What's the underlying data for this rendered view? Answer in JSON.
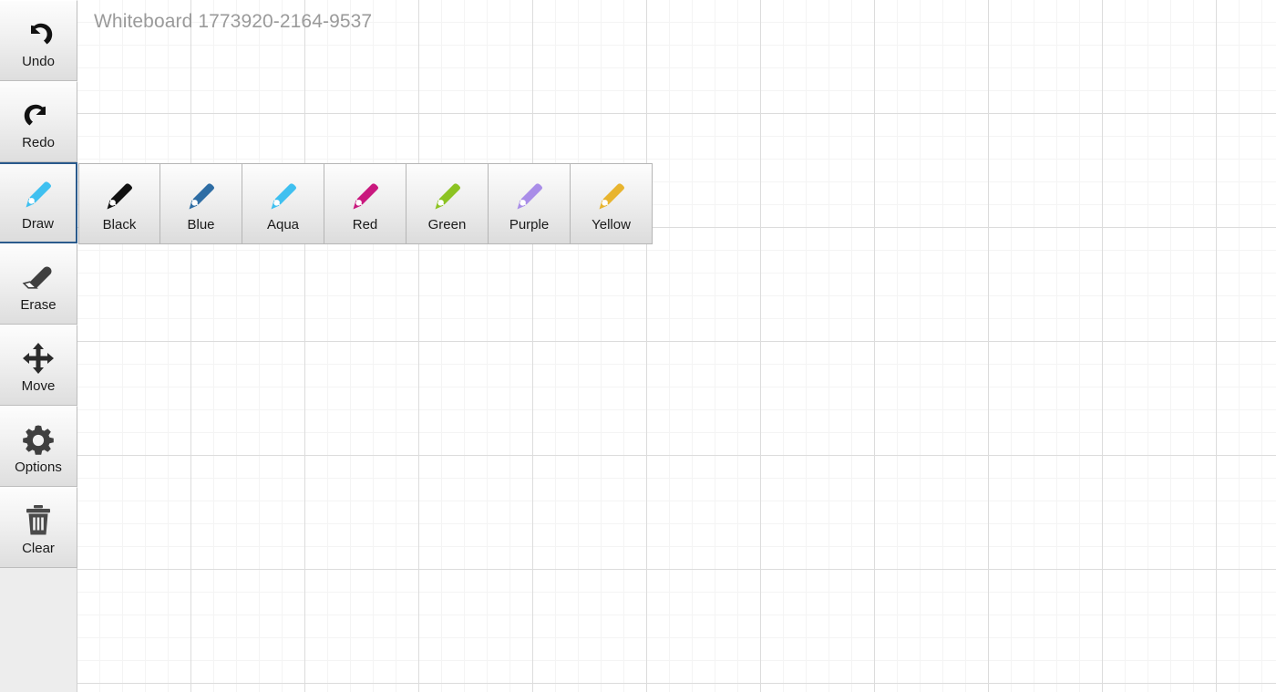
{
  "board": {
    "title": "Whiteboard 1773920-2164-9537",
    "background": "#ffffff",
    "grid_minor_color": "#f4f4f4",
    "grid_major_color": "#dcdcdc"
  },
  "sidebar": {
    "selected_tool": "Draw",
    "selected_border_color": "#2a5a8c",
    "items": [
      {
        "label": "Undo",
        "icon": "undo-arrow-icon",
        "icon_color": "#111111",
        "selected": false
      },
      {
        "label": "Redo",
        "icon": "redo-arrow-icon",
        "icon_color": "#111111",
        "selected": false
      },
      {
        "label": "Draw",
        "icon": "pencil-icon",
        "icon_color": "#3fc0f0",
        "selected": true
      },
      {
        "label": "Erase",
        "icon": "eraser-icon",
        "icon_color": "#3f3f3f",
        "selected": false
      },
      {
        "label": "Move",
        "icon": "move-arrows-icon",
        "icon_color": "#2b2b2b",
        "selected": false
      },
      {
        "label": "Options",
        "icon": "gear-icon",
        "icon_color": "#3f3f3f",
        "selected": false
      },
      {
        "label": "Clear",
        "icon": "trash-icon",
        "icon_color": "#4a4a4a",
        "selected": false
      }
    ]
  },
  "color_toolbar": {
    "selected_color": "Aqua",
    "colors": [
      {
        "label": "Black",
        "hex": "#111111",
        "icon": "pencil-icon"
      },
      {
        "label": "Blue",
        "hex": "#2e6da4",
        "icon": "pencil-icon"
      },
      {
        "label": "Aqua",
        "hex": "#3fc0f0",
        "icon": "pencil-icon"
      },
      {
        "label": "Red",
        "hex": "#c9187e",
        "icon": "pencil-icon"
      },
      {
        "label": "Green",
        "hex": "#8cc322",
        "icon": "pencil-icon"
      },
      {
        "label": "Purple",
        "hex": "#a98de8",
        "icon": "pencil-icon"
      },
      {
        "label": "Yellow",
        "hex": "#e8b42e",
        "icon": "pencil-icon"
      }
    ]
  }
}
